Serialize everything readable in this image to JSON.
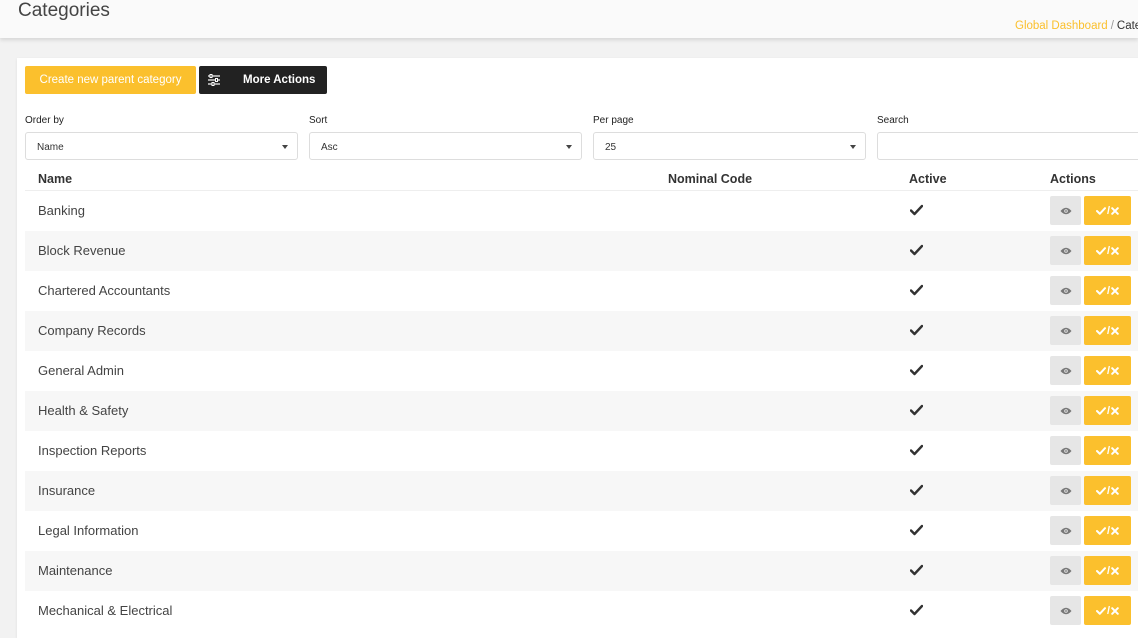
{
  "header": {
    "title": "Categories",
    "breadcrumb": {
      "link": "Global Dashboard",
      "separator": "/",
      "current": "Cate"
    }
  },
  "toolbar": {
    "create_label": "Create new parent category",
    "more_actions_label": "More Actions"
  },
  "filters": {
    "order_by": {
      "label": "Order by",
      "value": "Name"
    },
    "sort": {
      "label": "Sort",
      "value": "Asc"
    },
    "per_page": {
      "label": "Per page",
      "value": "25"
    },
    "search": {
      "label": "Search",
      "value": "",
      "placeholder": ""
    }
  },
  "table": {
    "columns": [
      "Name",
      "Nominal Code",
      "Active",
      "Actions"
    ],
    "rows": [
      {
        "name": "Banking",
        "nominal_code": "",
        "active": true
      },
      {
        "name": "Block Revenue",
        "nominal_code": "",
        "active": true
      },
      {
        "name": "Chartered Accountants",
        "nominal_code": "",
        "active": true
      },
      {
        "name": "Company Records",
        "nominal_code": "",
        "active": true
      },
      {
        "name": "General Admin",
        "nominal_code": "",
        "active": true
      },
      {
        "name": "Health & Safety",
        "nominal_code": "",
        "active": true
      },
      {
        "name": "Inspection Reports",
        "nominal_code": "",
        "active": true
      },
      {
        "name": "Insurance",
        "nominal_code": "",
        "active": true
      },
      {
        "name": "Legal Information",
        "nominal_code": "",
        "active": true
      },
      {
        "name": "Maintenance",
        "nominal_code": "",
        "active": true
      },
      {
        "name": "Mechanical & Electrical",
        "nominal_code": "",
        "active": true
      }
    ],
    "toggle_label_sep": "/"
  },
  "colors": {
    "accent": "#fbc02d",
    "dark_button": "#222222",
    "view_button": "#e6e6e6"
  },
  "icons": {
    "more_actions": "sliders-icon",
    "active": "check-icon",
    "view": "eye-icon",
    "toggle": "check-cross-icon"
  }
}
